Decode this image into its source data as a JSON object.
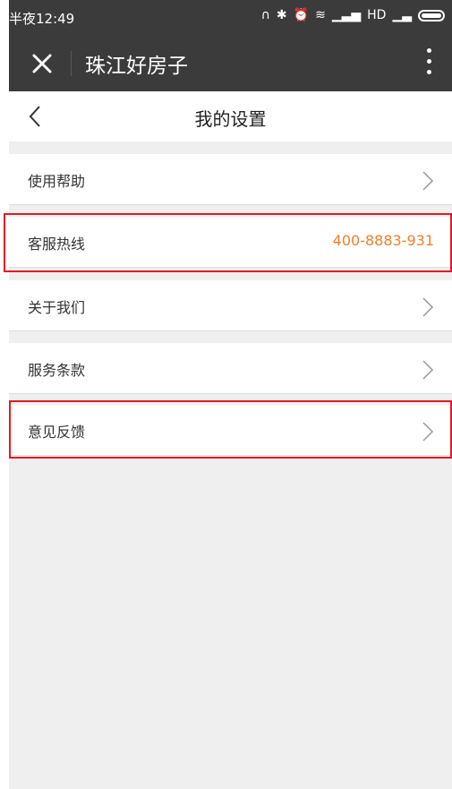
{
  "status_bar": {
    "time": "半夜12:49",
    "network": "HD"
  },
  "app": {
    "title": "珠江好房子"
  },
  "nav": {
    "title": "我的设置"
  },
  "settings": [
    {
      "label": "使用帮助"
    },
    {
      "label": "客服热线",
      "value": "400-8883-931"
    },
    {
      "label": "关于我们"
    },
    {
      "label": "服务条款"
    },
    {
      "label": "意见反馈"
    }
  ],
  "colors": {
    "header": "#3b3b3b",
    "accent": "#f07e2c",
    "highlight": "#e11b22",
    "background": "#efefef"
  }
}
